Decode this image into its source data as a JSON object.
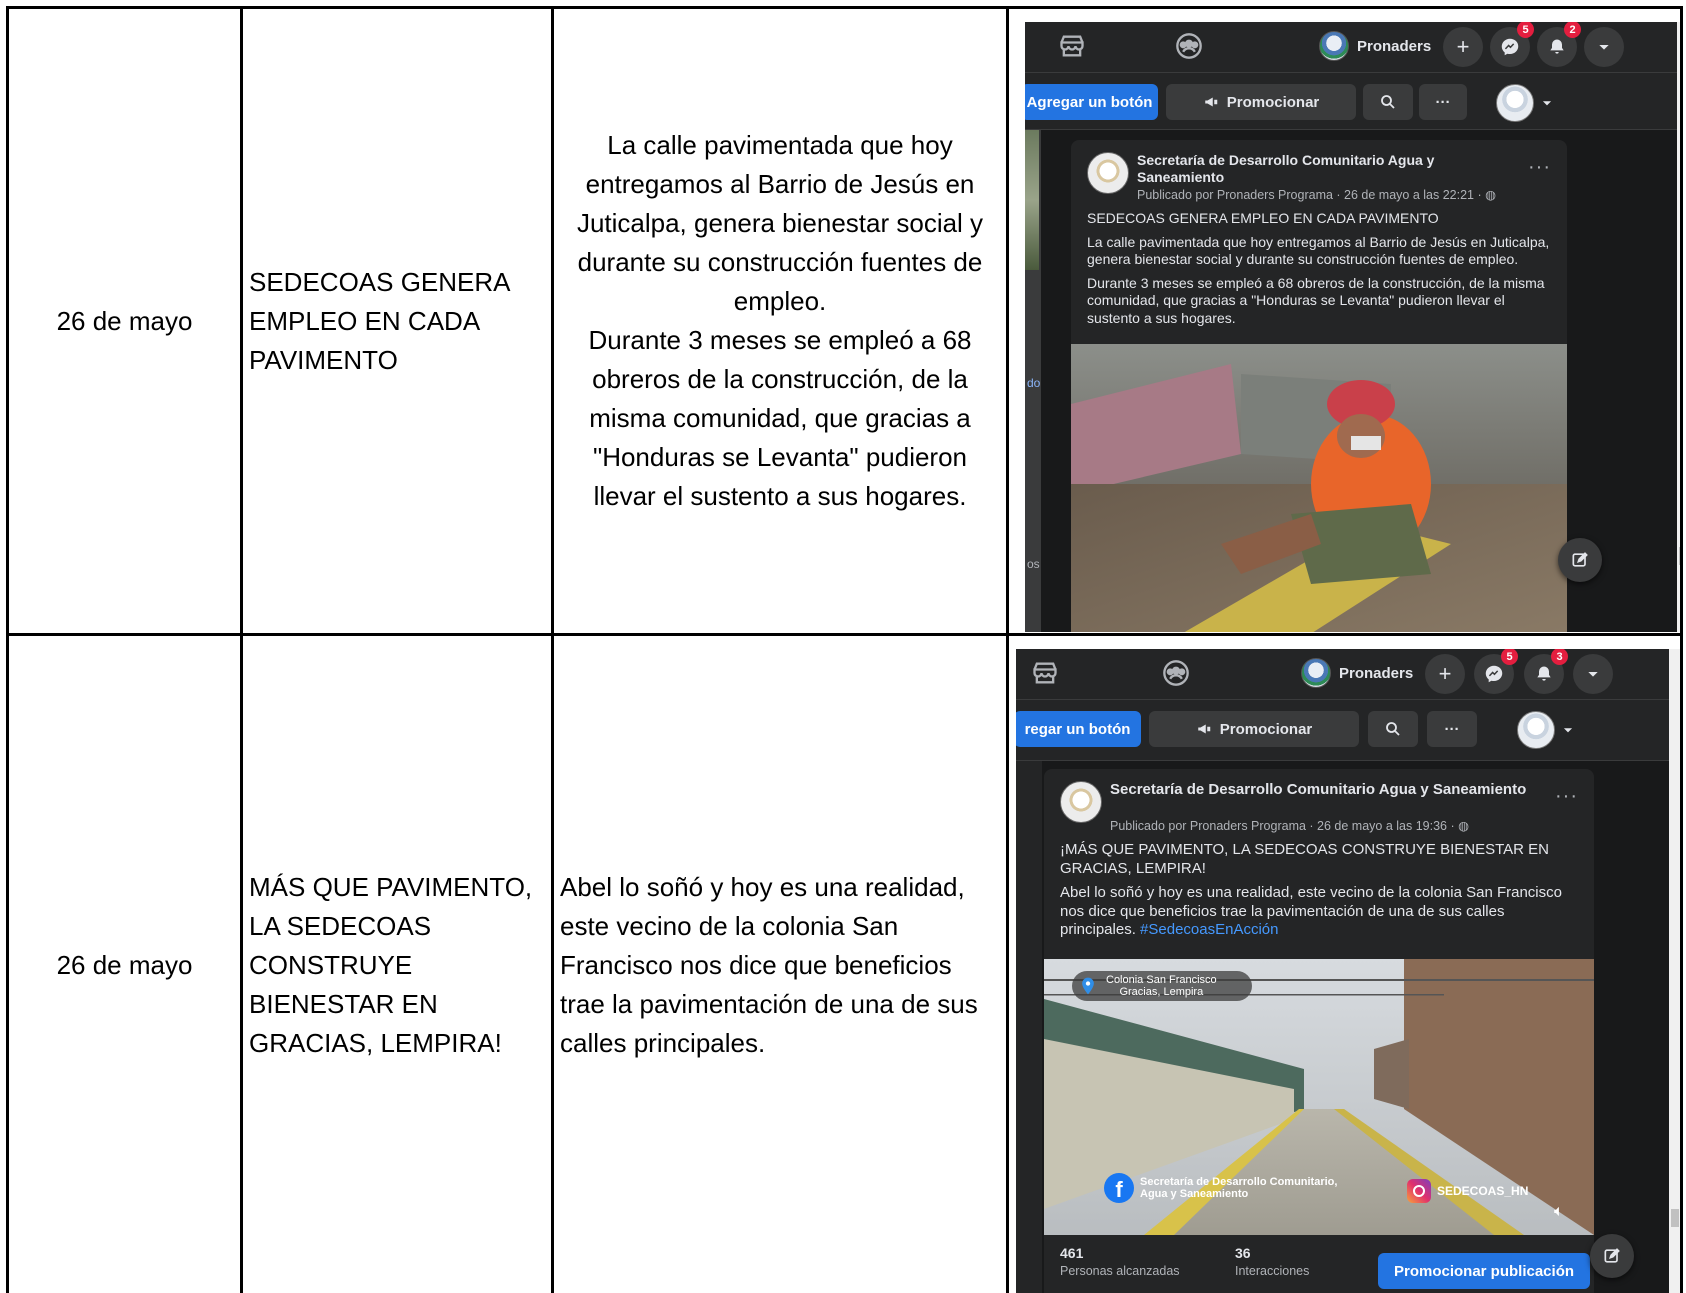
{
  "rows": [
    {
      "date": "26 de mayo",
      "title": "SEDECOAS GENERA EMPLEO EN CADA PAVIMENTO",
      "description": "La calle pavimentada que hoy entregamos al Barrio de Jesús en Juticalpa, genera bienestar social y durante su construcción fuentes de empleo.\nDurante 3 meses se empleó a 68 obreros de la construcción, de la misma comunidad, que gracias a \"Honduras se Levanta\" pudieron llevar el sustento a sus hogares.",
      "screenshot": {
        "page_name": "Pronaders",
        "messenger_badge": "5",
        "notifications_badge": "2",
        "add_button_label": "Agregar un botón",
        "promote_label": "Promocionar",
        "more_label": "···",
        "post_author": "Secretaría de Desarrollo Comunitario Agua y Saneamiento",
        "post_meta": "Publicado por Pronaders Programa · 26 de mayo a las 22:21 ·",
        "post_headline": "SEDECOAS GENERA EMPLEO EN CADA PAVIMENTO",
        "post_paragraph_1": "La calle pavimentada que hoy entregamos al Barrio de Jesús en Juticalpa, genera bienestar social y durante su construcción fuentes de empleo.",
        "post_paragraph_2": "Durante 3 meses se empleó a 68 obreros de la construcción, de la misma comunidad, que gracias a \"Honduras se Levanta\" pudieron llevar el sustento a sus hogares.",
        "left_fragments": [
          "do",
          "os"
        ]
      }
    },
    {
      "date": "26 de mayo",
      "title": "MÁS QUE PAVIMENTO, LA SEDECOAS CONSTRUYE BIENESTAR EN GRACIAS, LEMPIRA!",
      "description": "Abel lo soñó y hoy es una realidad, este vecino de la colonia San Francisco nos dice que beneficios trae la pavimentación de una de sus calles principales.",
      "screenshot": {
        "page_name": "Pronaders",
        "messenger_badge": "5",
        "notifications_badge": "3",
        "add_button_label": "regar un botón",
        "promote_label": "Promocionar",
        "more_label": "···",
        "post_author": "Secretaría de Desarrollo Comunitario Agua y Saneamiento",
        "post_meta": "Publicado por Pronaders Programa · 26 de mayo a las 19:36 ·",
        "post_headline": "¡MÁS QUE PAVIMENTO, LA SEDECOAS CONSTRUYE BIENESTAR EN GRACIAS, LEMPIRA!",
        "post_paragraph": "Abel lo soñó y hoy es una realidad, este vecino de la colonia San Francisco nos dice que beneficios trae la pavimentación de una de sus calles principales.",
        "hashtag": "#SedecoasEnAcción",
        "video_location_line1": "Colonia San Francisco",
        "video_location_line2": "Gracias, Lempira",
        "video_fb_line1": "Secretaría de Desarrollo Comunitario,",
        "video_fb_line2": "Agua y Saneamiento",
        "video_ig_handle": "SEDECOAS_HN",
        "reach_count": "461",
        "reach_label": "Personas alcanzadas",
        "interactions_count": "36",
        "interactions_label": "Interacciones",
        "promote_post_label": "Promocionar publicación"
      }
    }
  ]
}
